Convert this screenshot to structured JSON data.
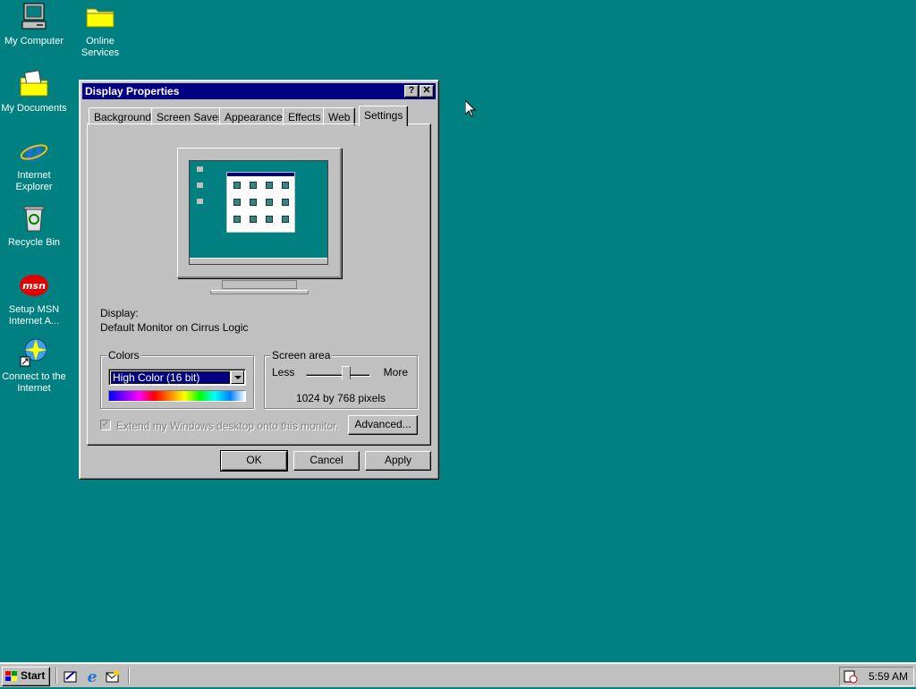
{
  "desktop": {
    "icons": [
      {
        "label": "My Computer",
        "icon": "my-computer-icon"
      },
      {
        "label": "Online Services",
        "icon": "folder-icon"
      },
      {
        "label": "My Documents",
        "icon": "my-documents-icon"
      },
      {
        "label": "Internet Explorer",
        "icon": "internet-explorer-icon"
      },
      {
        "label": "Recycle Bin",
        "icon": "recycle-bin-icon"
      },
      {
        "label": "Setup MSN Internet A...",
        "icon": "msn-icon"
      },
      {
        "label": "Connect to the Internet",
        "icon": "connect-internet-icon"
      }
    ]
  },
  "window": {
    "title": "Display Properties",
    "help_btn": "?",
    "close_btn": "✕",
    "tabs": [
      "Background",
      "Screen Saver",
      "Appearance",
      "Effects",
      "Web",
      "Settings"
    ],
    "active_tab": "Settings",
    "display_label": "Display:",
    "display_value": "Default Monitor on Cirrus Logic",
    "colors": {
      "label": "Colors",
      "selected": "High Color (16 bit)"
    },
    "screen_area": {
      "label": "Screen area",
      "less": "Less",
      "more": "More",
      "value": "1024 by 768 pixels",
      "slider_level": 0.62
    },
    "extend_checkbox": {
      "label": "Extend my Windows desktop onto this monitor.",
      "checked": true,
      "enabled": false
    },
    "advanced_btn": "Advanced...",
    "ok_btn": "OK",
    "cancel_btn": "Cancel",
    "apply_btn": "Apply"
  },
  "taskbar": {
    "start_label": "Start",
    "clock": "5:59 AM"
  },
  "colors": {
    "desktop": "#008080",
    "titlebar": "#000080",
    "face": "#c0c0c0"
  }
}
